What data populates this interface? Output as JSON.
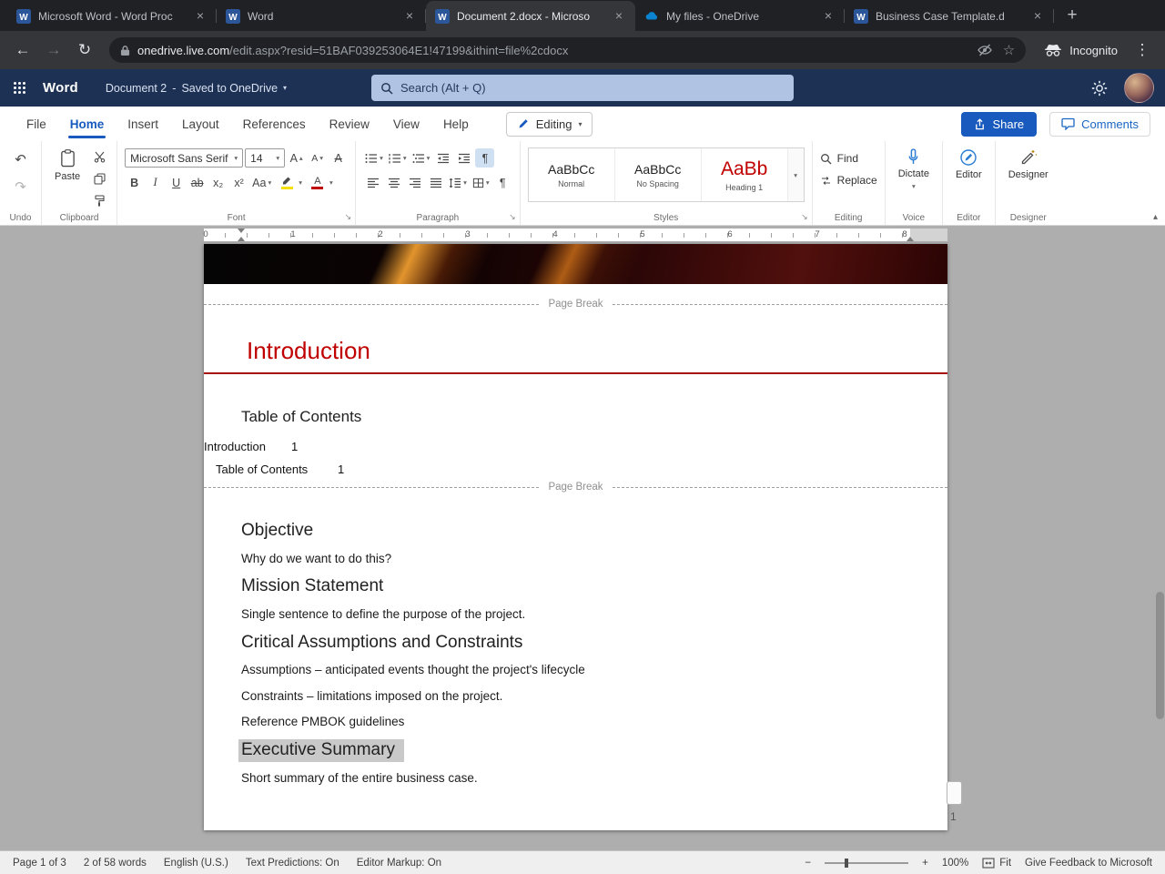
{
  "icons": {
    "close": "×",
    "new_tab": "+",
    "back": "←",
    "forward": "→",
    "reload": "↻",
    "star": "☆",
    "kebab": "⋮",
    "chevron": "▾",
    "collapse": "▴",
    "launcher": "↘",
    "undo": "↶",
    "redo": "↷",
    "pilcrow": "¶",
    "dash": "-",
    "minus": "−",
    "plus": "+",
    "bold": "B",
    "italic": "I",
    "underline": "U",
    "strike": "ab",
    "subscript": "x₂",
    "superscript": "x²",
    "change_case": "Aa",
    "letter_A": "A"
  },
  "colors": {
    "accent_blue": "#185abd",
    "heading_red": "#c00000"
  },
  "browser": {
    "tabs": [
      {
        "title": "Microsoft Word - Word Proc"
      },
      {
        "title": "Word"
      },
      {
        "title": "Document 2.docx - Microso"
      },
      {
        "title": "My files - OneDrive"
      },
      {
        "title": "Business Case Template.d"
      }
    ],
    "url_domain": "onedrive.live.com",
    "url_path": "/edit.aspx?resid=51BAF039253064E1!47199&ithint=file%2cdocx",
    "incognito_label": "Incognito"
  },
  "app_header": {
    "app_name": "Word",
    "doc_name": "Document 2",
    "save_status": "Saved to OneDrive",
    "search_placeholder": "Search (Alt + Q)"
  },
  "menu": {
    "file": "File",
    "home": "Home",
    "insert": "Insert",
    "layout": "Layout",
    "references": "References",
    "review": "Review",
    "view": "View",
    "help": "Help",
    "editing": "Editing",
    "share": "Share",
    "comments": "Comments"
  },
  "ribbon": {
    "paste": "Paste",
    "font_name": "Microsoft Sans Serif",
    "font_size": "14",
    "style_1_preview": "AaBbCc",
    "style_1_name": "Normal",
    "style_2_preview": "AaBbCc",
    "style_2_name": "No Spacing",
    "style_3_preview": "AaBb",
    "style_3_name": "Heading 1",
    "find": "Find",
    "replace": "Replace",
    "dictate": "Dictate",
    "editor": "Editor",
    "designer": "Designer",
    "labels": {
      "undo": "Undo",
      "clipboard": "Clipboard",
      "font": "Font",
      "paragraph": "Paragraph",
      "styles": "Styles",
      "editing": "Editing",
      "voice": "Voice",
      "editor": "Editor",
      "designer": "Designer"
    }
  },
  "ruler": {
    "numbers": [
      "0",
      "1",
      "2",
      "3",
      "4",
      "5",
      "6",
      "7",
      "8"
    ]
  },
  "doc": {
    "page_break": "Page Break",
    "intro_heading": "Introduction",
    "toc_heading": "Table of Contents",
    "toc_entry_1": "Introduction",
    "toc_page_1": "1",
    "toc_entry_2": "Table of Contents",
    "toc_page_2": "1",
    "objective_heading": "Objective",
    "objective_body": "Why do we want to do this?",
    "mission_heading": "Mission Statement",
    "mission_body": "Single sentence to define the purpose of the project.",
    "constraints_heading": "Critical Assumptions and Constraints",
    "assumptions_line": "Assumptions – anticipated events thought the project's lifecycle",
    "constraints_line": "Constraints – limitations imposed on the project.",
    "pmbok_line": "Reference PMBOK guidelines",
    "exec_heading": "Executive Summary",
    "exec_body": "Short summary of the entire business case.",
    "margin_page_number": "1"
  },
  "status": {
    "page": "Page 1 of 3",
    "words": "2 of 58 words",
    "language": "English (U.S.)",
    "predictions": "Text Predictions: On",
    "markup": "Editor Markup: On",
    "zoom": "100%",
    "fit": "Fit",
    "feedback": "Give Feedback to Microsoft"
  }
}
